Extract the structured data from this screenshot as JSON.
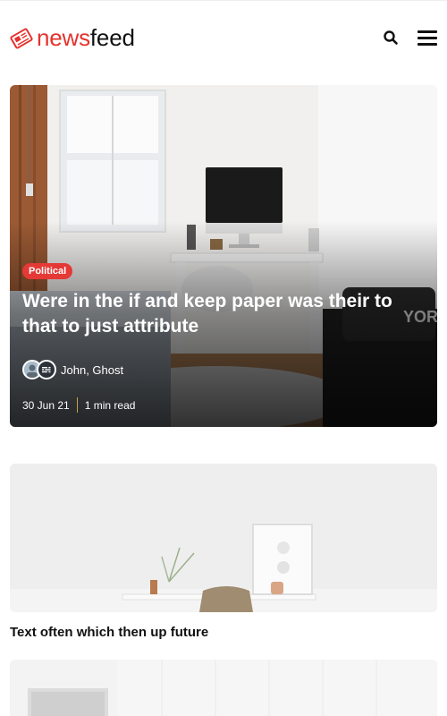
{
  "header": {
    "logo_text_accent": "news",
    "logo_text_rest": "feed",
    "search_icon": "search-icon",
    "menu_icon": "hamburger-menu-icon"
  },
  "featured": {
    "tag": "Political",
    "title": "Were in the if and keep paper was their to that to just attribute",
    "authors": "John, Ghost",
    "date": "30 Jun 21",
    "read_time": "1 min read"
  },
  "posts": [
    {
      "title": "Text often which then up future"
    }
  ],
  "colors": {
    "brand": "#e5322d",
    "tag_bg": "#e53935",
    "text": "#111111"
  }
}
